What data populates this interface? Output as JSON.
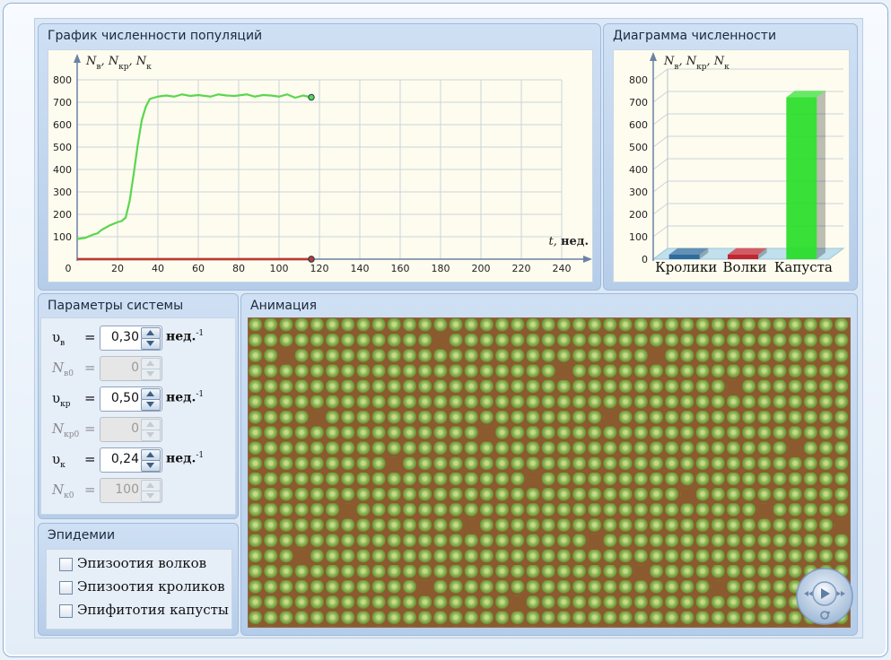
{
  "graph_panel": {
    "title": "График численности популяций"
  },
  "diagram_panel": {
    "title": "Диаграмма численности"
  },
  "params_panel": {
    "title": "Параметры системы"
  },
  "epidemics_panel": {
    "title": "Эпидемии"
  },
  "animation_panel": {
    "title": "Анимация"
  },
  "chart_data": [
    {
      "type": "line",
      "ylabel_main": "N",
      "ylabel_subs": [
        "в",
        "кр",
        "к"
      ],
      "xlabel_var": "t",
      "xlabel_unit": "нед.",
      "xlim": [
        0,
        240
      ],
      "ylim": [
        0,
        800
      ],
      "xticks": [
        "0",
        "20",
        "40",
        "60",
        "80",
        "100",
        "120",
        "140",
        "160",
        "180",
        "200",
        "220",
        "240"
      ],
      "yticks": [
        "100",
        "200",
        "300",
        "400",
        "500",
        "600",
        "700",
        "800"
      ],
      "grid": true,
      "series": [
        {
          "color": "#5ad64f",
          "x": [
            0,
            4,
            8,
            10,
            12,
            16,
            20,
            22,
            24,
            26,
            28,
            30,
            32,
            34,
            36,
            38,
            40,
            44,
            48,
            52,
            56,
            60,
            66,
            70,
            74,
            78,
            84,
            88,
            92,
            96,
            100,
            104,
            108,
            112,
            116
          ],
          "y": [
            90,
            95,
            110,
            115,
            130,
            150,
            165,
            170,
            185,
            260,
            380,
            510,
            620,
            680,
            715,
            720,
            725,
            730,
            725,
            735,
            728,
            732,
            725,
            735,
            730,
            728,
            735,
            725,
            732,
            730,
            725,
            735,
            720,
            730,
            722
          ]
        },
        {
          "color": "#4f7fb6",
          "x": [
            0,
            116
          ],
          "y": [
            0,
            0
          ]
        },
        {
          "color": "#c0392b",
          "x": [
            0,
            116
          ],
          "y": [
            0,
            0
          ]
        }
      ]
    },
    {
      "type": "bar",
      "ylabel_main": "N",
      "ylabel_subs": [
        "в",
        "кр",
        "к"
      ],
      "ylim": [
        0,
        800
      ],
      "yticks": [
        "0",
        "100",
        "200",
        "300",
        "400",
        "500",
        "600",
        "700",
        "800"
      ],
      "categories": [
        "Кролики",
        "Волки",
        "Капуста"
      ],
      "values": [
        0,
        0,
        722
      ],
      "colors": [
        "#1f5f95",
        "#c1121c",
        "#22dd22"
      ]
    }
  ],
  "params": [
    {
      "sym": "υ",
      "sub": "в",
      "value": "0,30",
      "unit": "нед.",
      "sup": "-1",
      "disabled": false
    },
    {
      "sym": "N",
      "sub": "в0",
      "value": "0",
      "unit": "",
      "sup": "",
      "disabled": true
    },
    {
      "sym": "υ",
      "sub": "кр",
      "value": "0,50",
      "unit": "нед.",
      "sup": "-1",
      "disabled": false
    },
    {
      "sym": "N",
      "sub": "кр0",
      "value": "0",
      "unit": "",
      "sup": "",
      "disabled": true
    },
    {
      "sym": "υ",
      "sub": "к",
      "value": "0,24",
      "unit": "нед.",
      "sup": "-1",
      "disabled": false
    },
    {
      "sym": "N",
      "sub": "к0",
      "value": "100",
      "unit": "",
      "sup": "",
      "disabled": true
    }
  ],
  "equals": "=",
  "epidemics": [
    {
      "label": "Эпизоотия волков",
      "checked": false
    },
    {
      "label": "Эпизоотия кроликов",
      "checked": false
    },
    {
      "label": "Эпифитотия капусты",
      "checked": false
    }
  ],
  "colors": {
    "paper": "#fdfcee",
    "panel": "#c3d7ee",
    "soil": "#8b5a2e",
    "cabbage": "#97bb5a"
  },
  "icons": [
    "play-icon",
    "rewind-icon",
    "forward-icon",
    "reset-icon"
  ]
}
